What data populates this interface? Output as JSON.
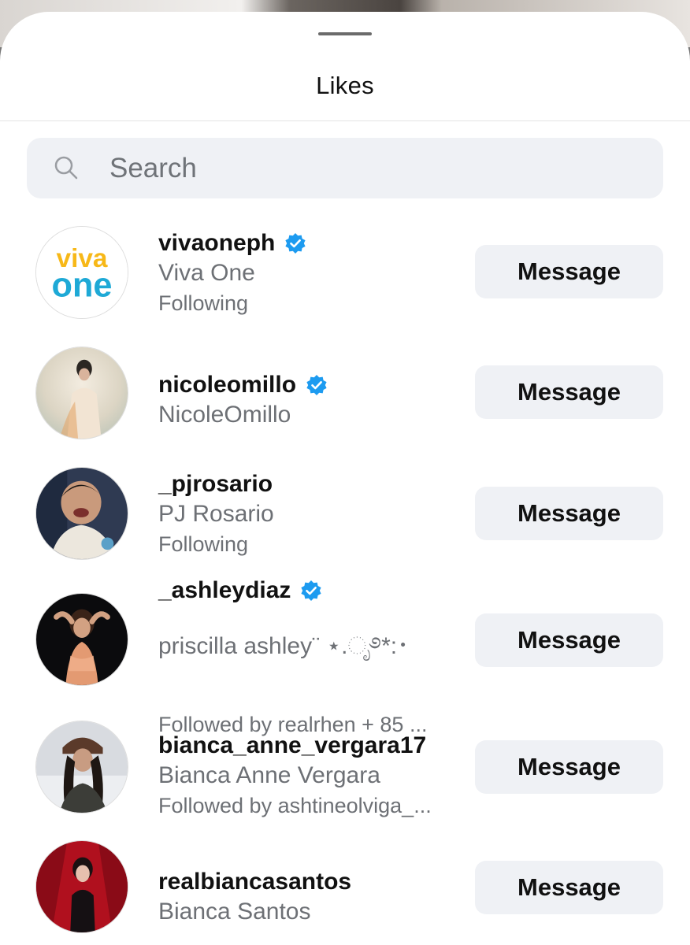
{
  "sheet": {
    "title": "Likes"
  },
  "search": {
    "placeholder": "Search",
    "value": ""
  },
  "users": [
    {
      "username": "vivaoneph",
      "verified": true,
      "full_name": "Viva One",
      "subtitle": "Following",
      "button": "Message"
    },
    {
      "username": "nicoleomillo",
      "verified": true,
      "full_name": "NicoleOmillo",
      "subtitle": "",
      "button": "Message"
    },
    {
      "username": "_pjrosario",
      "verified": false,
      "full_name": "PJ Rosario",
      "subtitle": "Following",
      "button": "Message"
    },
    {
      "username": "_ashleydiaz",
      "verified": true,
      "full_name": "priscilla ashley¨ ⋆.ೃ࿔*:･",
      "subtitle": "Followed by realrhen + 85 ...",
      "button": "Message"
    },
    {
      "username": "bianca_anne_vergara17",
      "verified": false,
      "full_name": "Bianca Anne Vergara",
      "subtitle": "Followed by ashtineolviga_...",
      "button": "Message"
    },
    {
      "username": "realbiancasantos",
      "verified": false,
      "full_name": "Bianca Santos",
      "subtitle": "",
      "button": "Message"
    }
  ],
  "logo_text": {
    "line1": "viva",
    "line2": "one"
  },
  "colors": {
    "verified_blue": "#1d9bf0",
    "button_bg": "#eff1f5",
    "secondary_text": "#6d7075"
  }
}
